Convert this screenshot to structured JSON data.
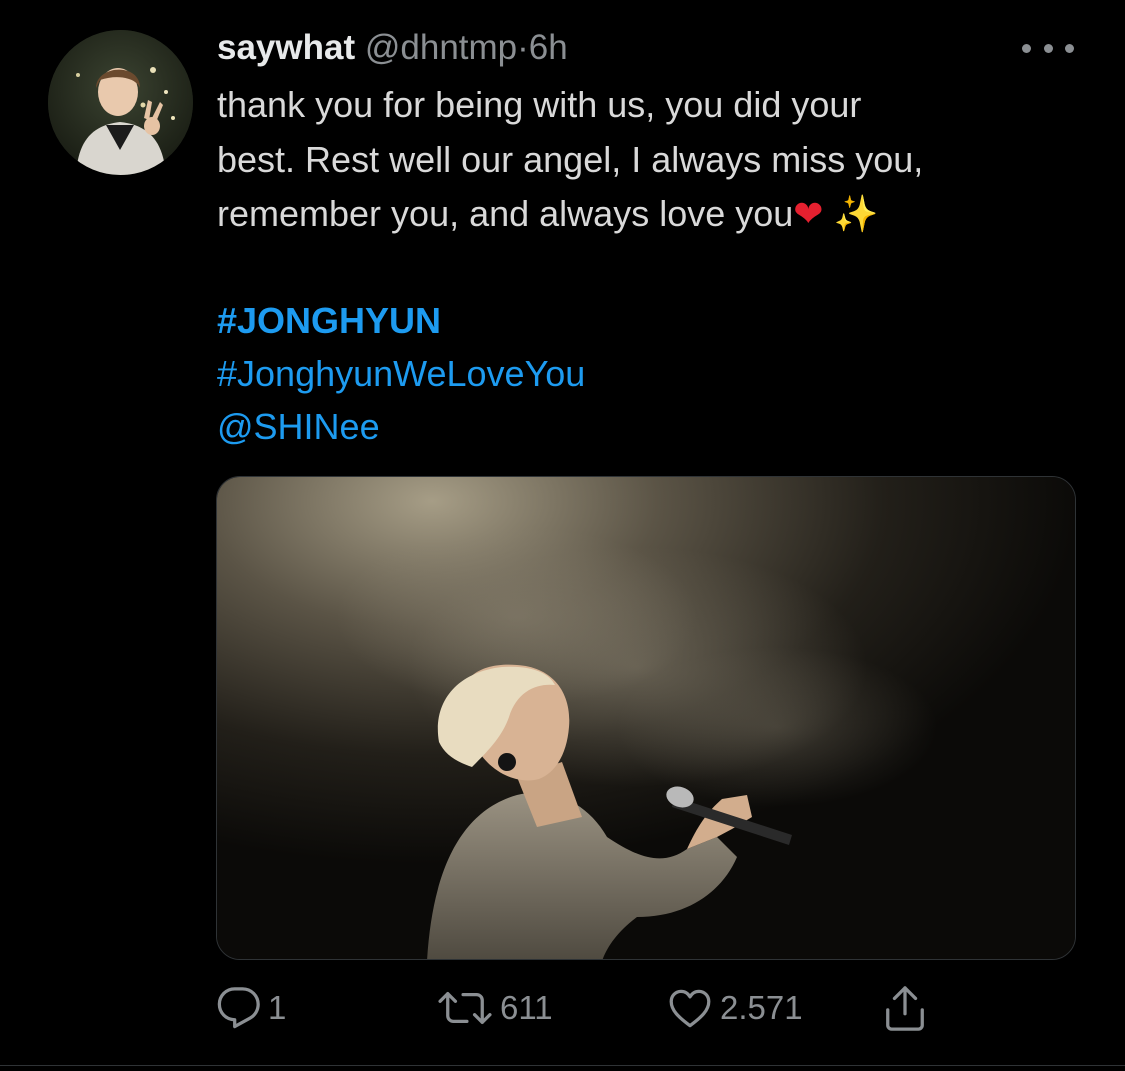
{
  "tweet": {
    "display_name": "saywhat",
    "handle": "@dhntmp",
    "separator": "·",
    "time": "6h",
    "text": "thank you for being with us, you did your\nbest. Rest well our angel, I always miss you,\nremember you, and always love you",
    "emoji_heart": "❤",
    "emoji_sparkles": "✨",
    "hashtags": [
      "#JONGHYUN",
      "#JonghyunWeLoveYou"
    ],
    "mention": "@SHINee"
  },
  "actions": {
    "reply_count": "1",
    "retweet_count": "611",
    "like_count": "2.571"
  },
  "icons": {
    "more": "more-horizontal-icon",
    "reply": "reply-icon",
    "retweet": "retweet-icon",
    "like": "heart-icon",
    "share": "share-icon"
  },
  "colors": {
    "background": "#000000",
    "text": "#d9d9d9",
    "muted": "#8b8f93",
    "link": "#1d9bf0"
  }
}
